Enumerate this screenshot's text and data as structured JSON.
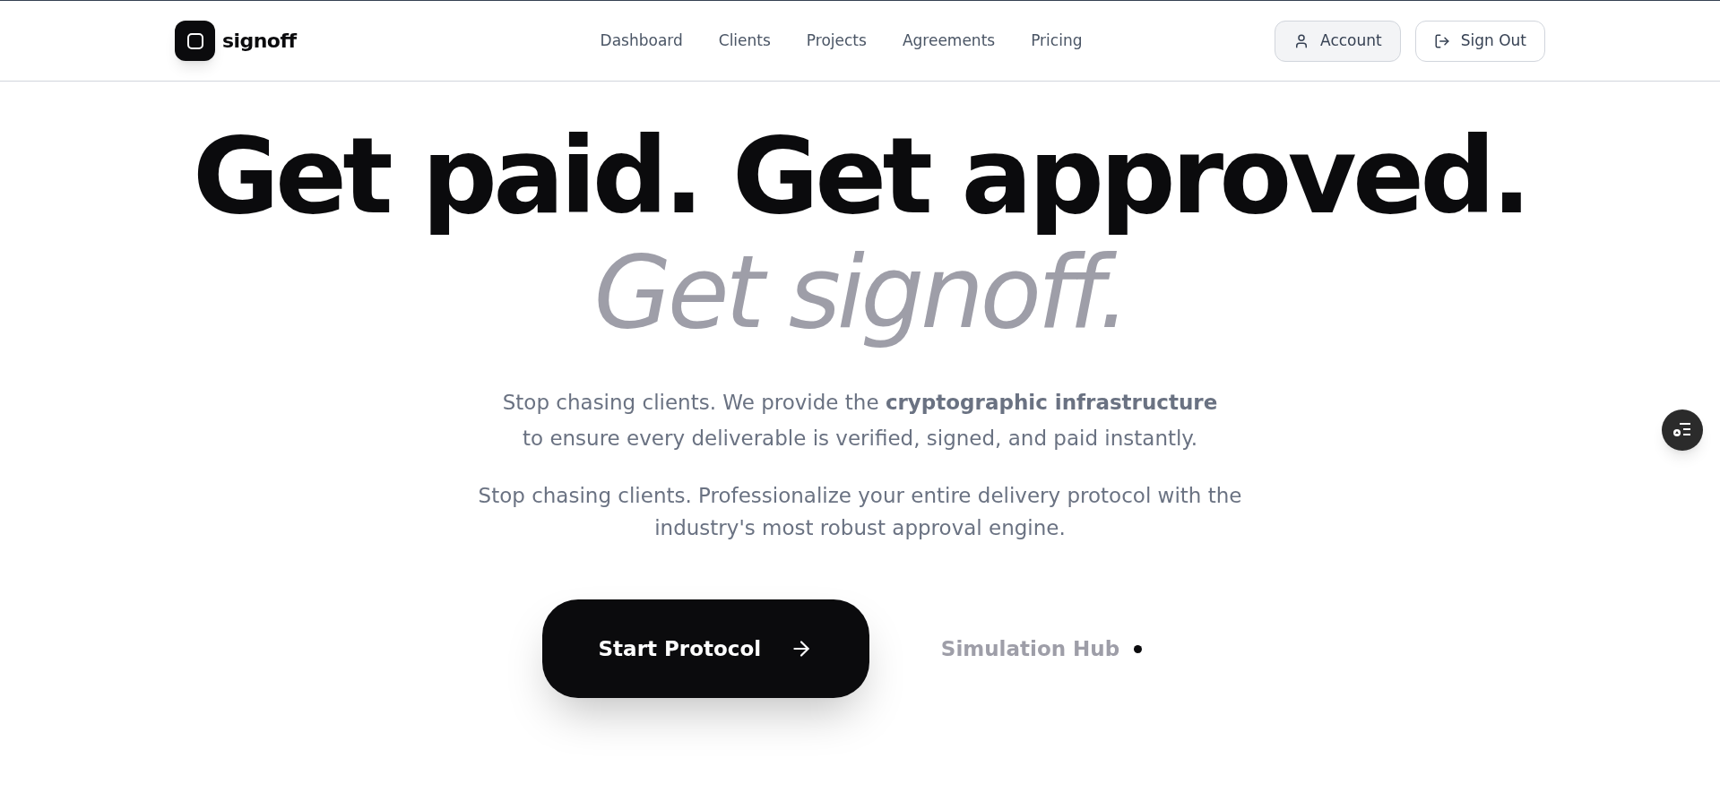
{
  "brand": {
    "name": "signoff"
  },
  "nav": [
    {
      "label": "Dashboard"
    },
    {
      "label": "Clients"
    },
    {
      "label": "Projects"
    },
    {
      "label": "Agreements"
    },
    {
      "label": "Pricing"
    }
  ],
  "actions": [
    {
      "label": "Account",
      "kind": "account"
    },
    {
      "label": "Sign Out",
      "kind": "signout"
    }
  ],
  "hero": {
    "headline": "Get paid. Get approved.",
    "subheadline": "Get signoff.",
    "lead": "Stop chasing clients. We provide the **cryptographic infrastructure** to ensure every deliverable is verified, signed, and paid instantly.",
    "body": "Stop chasing clients. Professionalize your entire delivery protocol with the industry's most robust approval engine.",
    "primary": {
      "label": "Start Protocol"
    },
    "secondary": {
      "label": "Simulation Hub"
    }
  }
}
